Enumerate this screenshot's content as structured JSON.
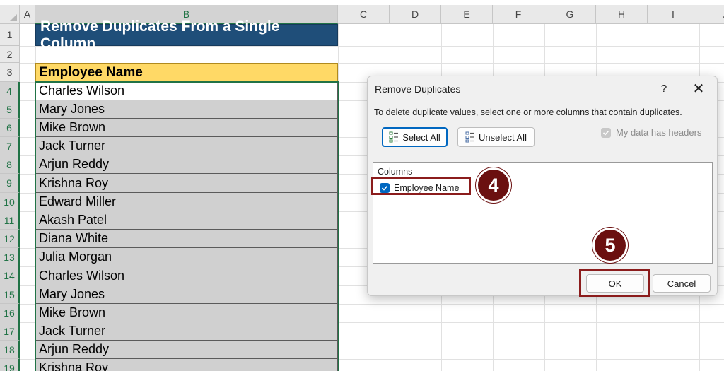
{
  "spreadsheet": {
    "columns": [
      "A",
      "B",
      "C",
      "D",
      "E",
      "F",
      "G",
      "H",
      "I",
      "J"
    ],
    "rows": [
      "1",
      "2",
      "3",
      "4",
      "5",
      "6",
      "7",
      "8",
      "9",
      "10",
      "11",
      "12",
      "13",
      "14",
      "15",
      "16",
      "17",
      "18",
      "19"
    ],
    "title": "Remove Duplicates From a Single Column",
    "header": "Employee Name",
    "names": [
      "Charles Wilson",
      "Mary Jones",
      "Mike Brown",
      "Jack Turner",
      "Arjun Reddy",
      "Krishna Roy",
      "Edward Miller",
      "Akash Patel",
      "Diana White",
      "Julia Morgan",
      "Charles Wilson",
      "Mary Jones",
      "Mike Brown",
      "Jack Turner",
      "Arjun Reddy",
      "Krishna Roy"
    ]
  },
  "dialog": {
    "title": "Remove Duplicates",
    "help": "?",
    "close": "✕",
    "description": "To delete duplicate values, select one or more columns that contain duplicates.",
    "select_all": "Select All",
    "unselect_all": "Unselect All",
    "headers_checkbox": "My data has headers",
    "columns_label": "Columns",
    "column_item": "Employee Name",
    "ok": "OK",
    "cancel": "Cancel"
  },
  "annotations": {
    "step4": "4",
    "step5": "5"
  },
  "colors": {
    "title_bg": "#1f4e79",
    "header_bg": "#ffd966",
    "selection": "#217346",
    "badge": "#6b1010",
    "accent": "#0067c0"
  }
}
